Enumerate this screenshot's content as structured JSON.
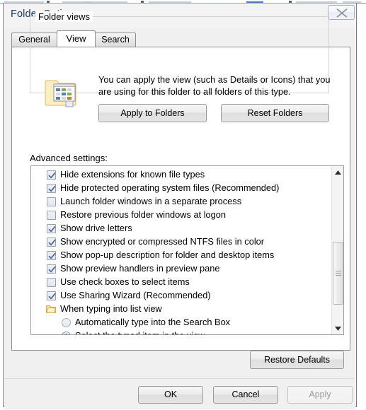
{
  "window": {
    "title": "Folder Options",
    "close_icon": "close-x-icon"
  },
  "tabs": [
    {
      "label": "General",
      "active": false
    },
    {
      "label": "View",
      "active": true
    },
    {
      "label": "Search",
      "active": false
    }
  ],
  "folder_views": {
    "legend": "Folder views",
    "icon": "folder-views-icon",
    "description": "You can apply the view (such as Details or Icons) that you are using for this folder to all folders of this type.",
    "apply_to_folders_label": "Apply to Folders",
    "reset_folders_label": "Reset Folders"
  },
  "advanced": {
    "label": "Advanced settings:",
    "items": [
      {
        "type": "checkbox",
        "label": "Hide extensions for known file types",
        "checked": true,
        "indent": 0
      },
      {
        "type": "checkbox",
        "label": "Hide protected operating system files (Recommended)",
        "checked": true,
        "indent": 0
      },
      {
        "type": "checkbox",
        "label": "Launch folder windows in a separate process",
        "checked": false,
        "indent": 0
      },
      {
        "type": "checkbox",
        "label": "Restore previous folder windows at logon",
        "checked": false,
        "indent": 0
      },
      {
        "type": "checkbox",
        "label": "Show drive letters",
        "checked": true,
        "indent": 0
      },
      {
        "type": "checkbox",
        "label": "Show encrypted or compressed NTFS files in color",
        "checked": true,
        "indent": 0
      },
      {
        "type": "checkbox",
        "label": "Show pop-up description for folder and desktop items",
        "checked": true,
        "indent": 0
      },
      {
        "type": "checkbox",
        "label": "Show preview handlers in preview pane",
        "checked": true,
        "indent": 0
      },
      {
        "type": "checkbox",
        "label": "Use check boxes to select items",
        "checked": false,
        "indent": 0
      },
      {
        "type": "checkbox",
        "label": "Use Sharing Wizard (Recommended)",
        "checked": true,
        "indent": 0
      },
      {
        "type": "node",
        "label": "When typing into list view",
        "checked": false,
        "indent": 0
      },
      {
        "type": "radio",
        "label": "Automatically type into the Search Box",
        "checked": false,
        "indent": 1
      },
      {
        "type": "radio",
        "label": "Select the typed item in the view",
        "checked": true,
        "indent": 1
      }
    ],
    "scrollbar": {
      "up_icon": "scroll-up-arrow-icon",
      "down_icon": "scroll-down-arrow-icon"
    }
  },
  "restore_defaults_label": "Restore Defaults",
  "footer": {
    "ok_label": "OK",
    "cancel_label": "Cancel",
    "apply_label": "Apply",
    "apply_enabled": false
  },
  "colors": {
    "dialog_bg": "#f0f0f0",
    "page_bg": "#ffffff",
    "title_text": "#1b3a5c",
    "radio_accent": "#1a8fb5",
    "check_accent": "#4a6a94"
  }
}
